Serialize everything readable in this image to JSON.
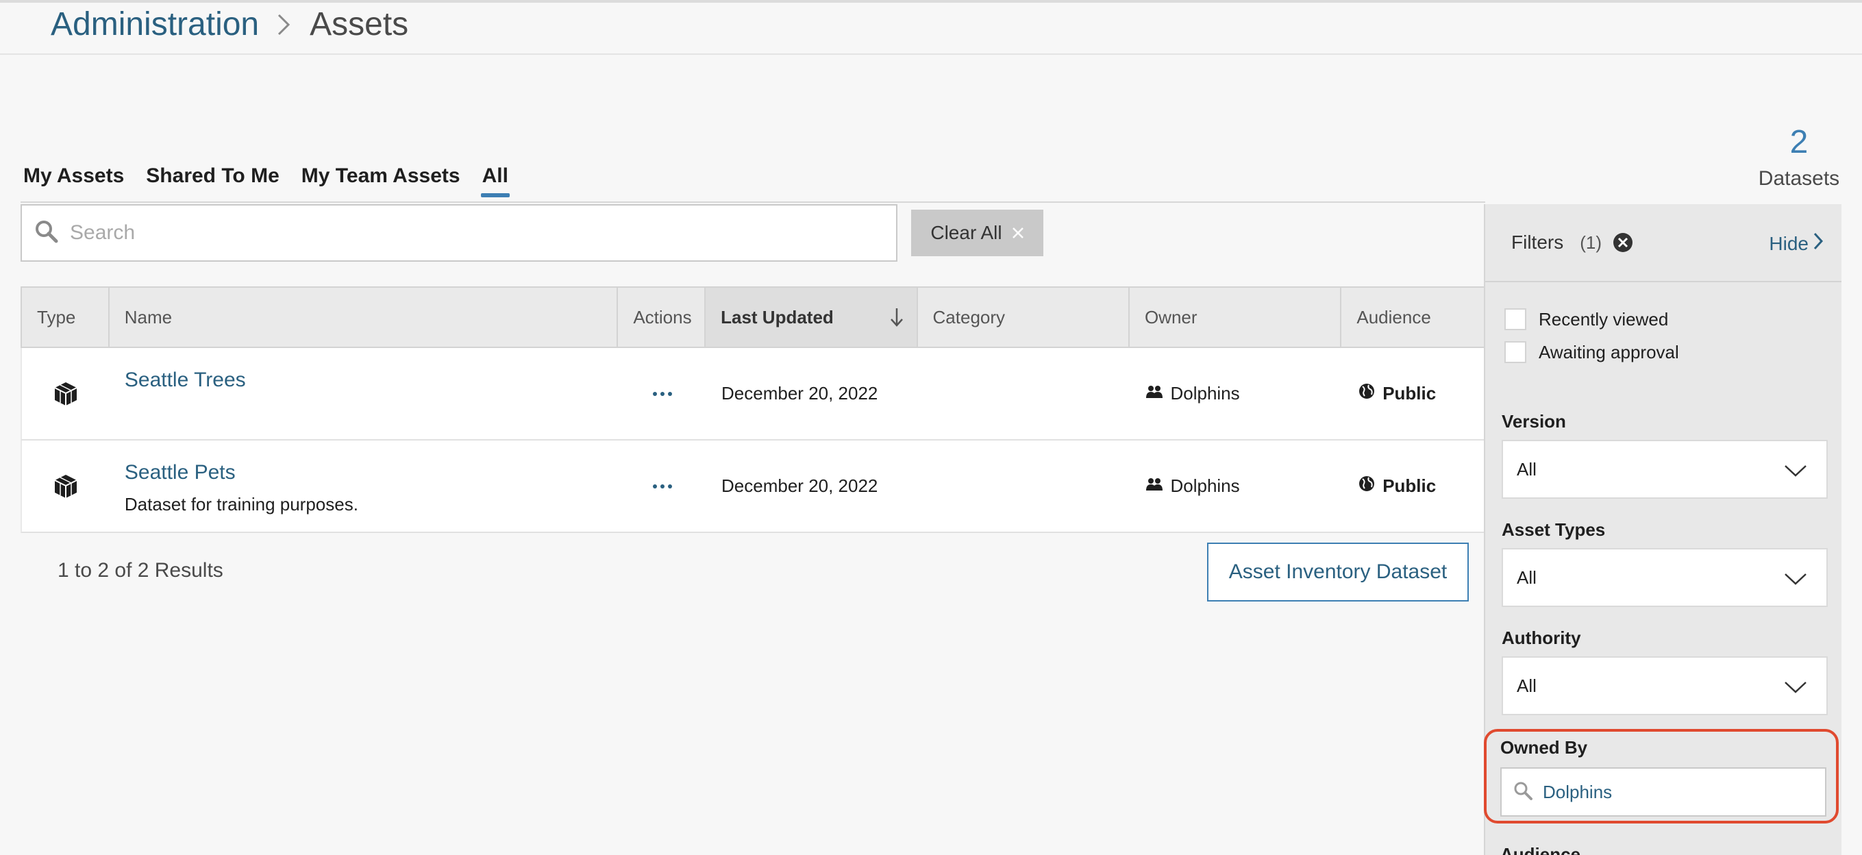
{
  "breadcrumb": {
    "parent": "Administration",
    "current": "Assets"
  },
  "summary": {
    "count": "2",
    "label": "Datasets"
  },
  "tabs": [
    {
      "label": "My Assets",
      "active": false
    },
    {
      "label": "Shared To Me",
      "active": false
    },
    {
      "label": "My Team Assets",
      "active": false
    },
    {
      "label": "All",
      "active": true
    }
  ],
  "search": {
    "placeholder": "Search",
    "value": ""
  },
  "clear_all": {
    "label": "Clear All",
    "icon": "close-icon"
  },
  "table": {
    "columns": [
      "Type",
      "Name",
      "Actions",
      "Last Updated",
      "Category",
      "Owner",
      "Audience"
    ],
    "sorted_column": "Last Updated",
    "rows": [
      {
        "type_icon": "dataset-cube-icon",
        "name": "Seattle Trees",
        "description": "",
        "last_updated": "December 20, 2022",
        "category": "",
        "owner": "Dolphins",
        "audience": "Public"
      },
      {
        "type_icon": "dataset-cube-icon",
        "name": "Seattle Pets",
        "description": "Dataset for training purposes.",
        "last_updated": "December 20, 2022",
        "category": "",
        "owner": "Dolphins",
        "audience": "Public"
      }
    ]
  },
  "results": "1 to 2 of 2 Results",
  "inventory_button": "Asset Inventory Dataset",
  "filters": {
    "title": "Filters",
    "count": "(1)",
    "hide_label": "Hide",
    "checkboxes": [
      {
        "label": "Recently viewed",
        "checked": false
      },
      {
        "label": "Awaiting approval",
        "checked": false
      }
    ],
    "version": {
      "label": "Version",
      "value": "All"
    },
    "asset_types": {
      "label": "Asset Types",
      "value": "All"
    },
    "authority": {
      "label": "Authority",
      "value": "All"
    },
    "owned_by": {
      "label": "Owned By",
      "value": "Dolphins"
    },
    "audience": {
      "label": "Audience"
    }
  },
  "colors": {
    "accent": "#3d7fb3",
    "link": "#2a6080",
    "highlight": "#e04a2f"
  }
}
